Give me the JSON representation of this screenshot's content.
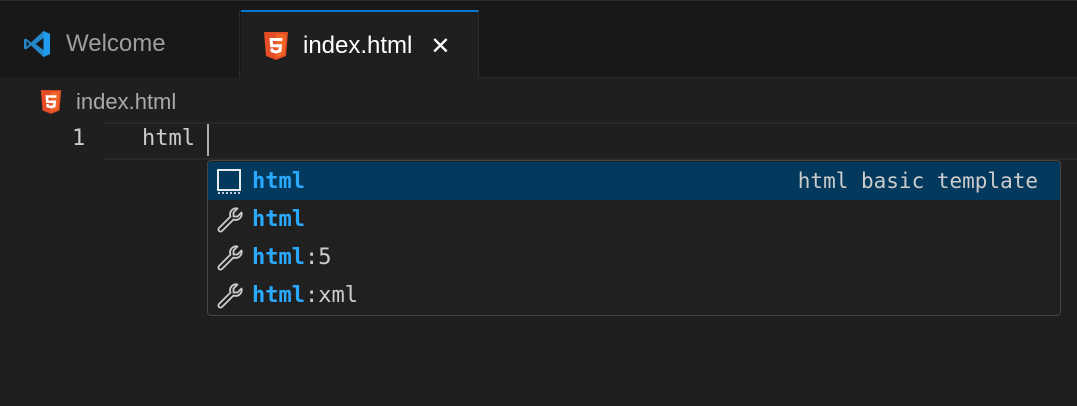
{
  "tabs": [
    {
      "label": "Welcome",
      "icon": "vscode-logo-icon",
      "active": false
    },
    {
      "label": "index.html",
      "icon": "html5-icon",
      "active": true,
      "close": "✕"
    }
  ],
  "breadcrumb": {
    "label": "index.html",
    "icon": "html5-icon"
  },
  "editor": {
    "line_number": "1",
    "line_text": "html"
  },
  "suggestions": [
    {
      "match": "html",
      "rest": "",
      "detail": "html basic template",
      "icon": "snippet-icon",
      "selected": true
    },
    {
      "match": "html",
      "rest": "",
      "detail": "",
      "icon": "wrench-icon",
      "selected": false
    },
    {
      "match": "html",
      "rest": ":5",
      "detail": "",
      "icon": "wrench-icon",
      "selected": false
    },
    {
      "match": "html",
      "rest": ":xml",
      "detail": "",
      "icon": "wrench-icon",
      "selected": false
    }
  ],
  "colors": {
    "accent": "#0078d4",
    "match": "#2aaaff",
    "selected_bg": "#04395e",
    "html5": "#e44d26"
  }
}
